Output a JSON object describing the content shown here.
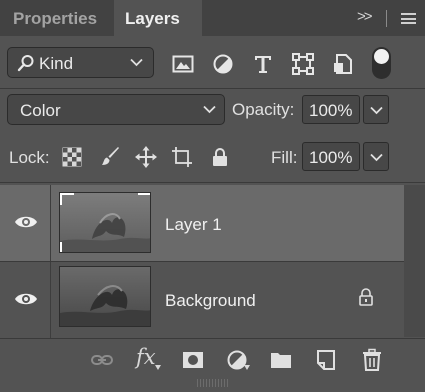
{
  "tabs": {
    "properties": "Properties",
    "layers": "Layers",
    "collapse": ">>"
  },
  "filter": {
    "kind_label": "Kind",
    "icons": [
      "image-filter-icon",
      "adjustment-filter-icon",
      "type-filter-icon",
      "shape-filter-icon",
      "smart-object-filter-icon"
    ],
    "filter_toggle_on": true
  },
  "blend": {
    "mode": "Color",
    "opacity_label": "Opacity:",
    "opacity_value": "100%"
  },
  "lock": {
    "label": "Lock:",
    "fill_label": "Fill:",
    "fill_value": "100%"
  },
  "layers": [
    {
      "name": "Layer 1",
      "visible": true,
      "selected": true,
      "locked": false
    },
    {
      "name": "Background",
      "visible": true,
      "selected": false,
      "locked": true
    }
  ],
  "bottom": {
    "fx_label": "fx"
  },
  "colors": {
    "panel": "#535353",
    "tabbar": "#424242",
    "selected_row": "#6a6a6a"
  }
}
